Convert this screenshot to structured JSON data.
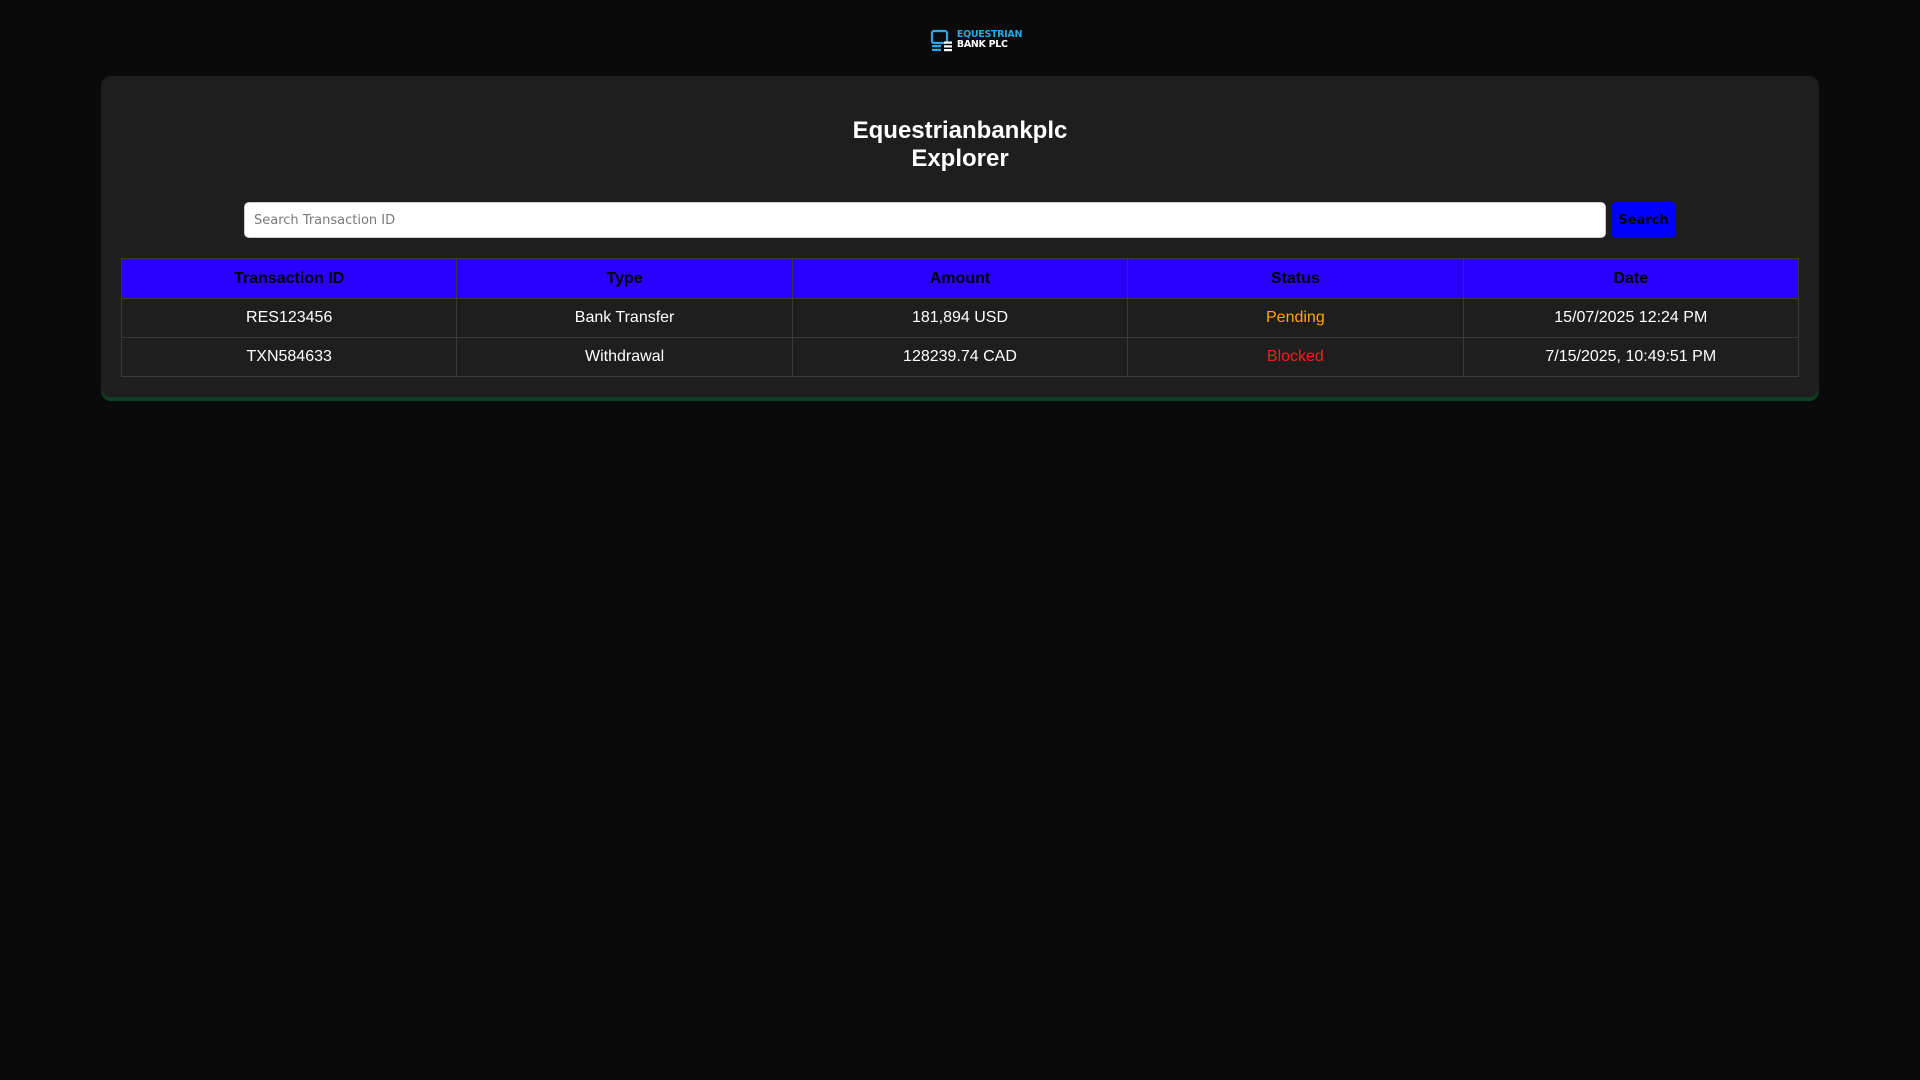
{
  "brand": {
    "line1": "EQUESTRIAN",
    "line2": "BANK PLC",
    "colors": {
      "primary": "#27a8e8",
      "secondary": "#ffffff"
    }
  },
  "page": {
    "title_line1": "Equestrianbankplc",
    "title_line2": "Explorer"
  },
  "search": {
    "placeholder": "Search Transaction ID",
    "value": "",
    "button_label": "Search"
  },
  "table": {
    "columns": [
      "Transaction ID",
      "Type",
      "Amount",
      "Status",
      "Date"
    ],
    "rows": [
      {
        "id": "RES123456",
        "type": "Bank Transfer",
        "amount": "181,894 USD",
        "status": "Pending",
        "status_color": "#ffa500",
        "date": "15/07/2025 12:24 PM"
      },
      {
        "id": "TXN584633",
        "type": "Withdrawal",
        "amount": "128239.74 CAD",
        "status": "Blocked",
        "status_color": "#ff1a1a",
        "date": "7/15/2025, 10:49:51 PM"
      }
    ]
  },
  "colors": {
    "background": "#0a0a0a",
    "panel": "#1e1e1e",
    "header_bg": "#2a00ff",
    "search_button": "#0000ff",
    "panel_accent": "#0e3d22"
  }
}
